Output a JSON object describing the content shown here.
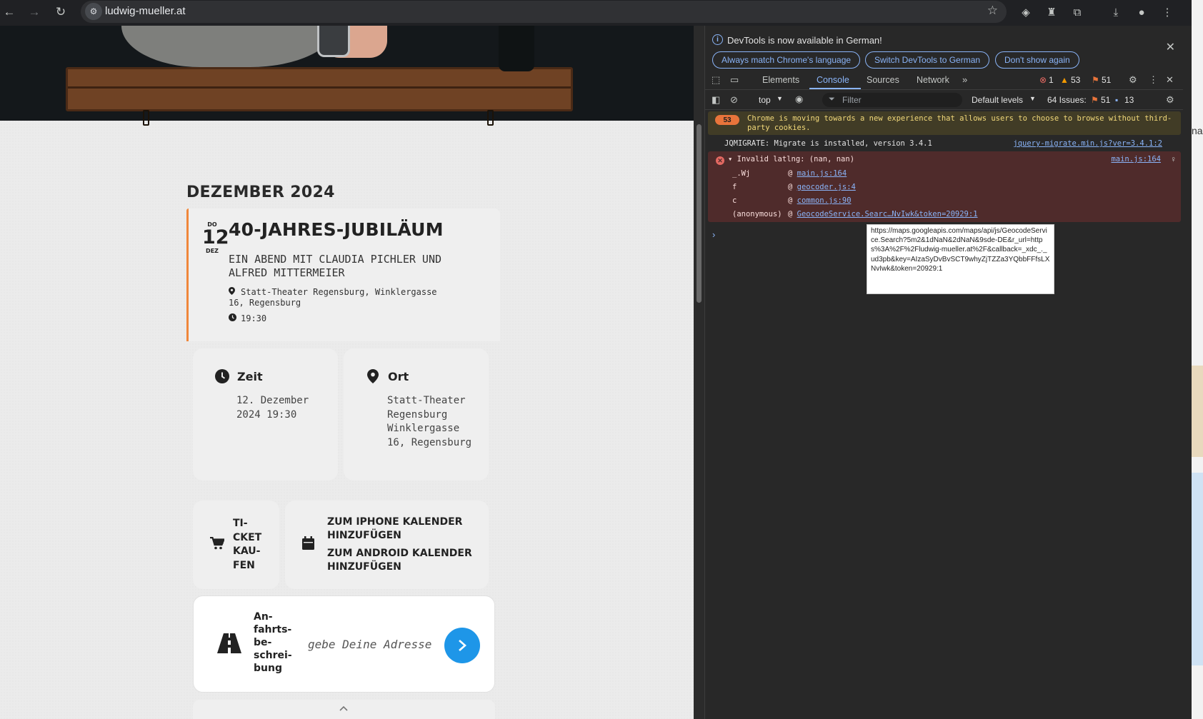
{
  "browser": {
    "url": "ludwig-mueller.at",
    "icons": [
      "back-icon",
      "forward-icon",
      "reload-icon",
      "site-settings-icon",
      "bookmark-star-icon",
      "shield-extension-icon",
      "hat-extension-icon",
      "extensions-icon",
      "download-icon",
      "profile-icon",
      "menu-icon"
    ]
  },
  "page": {
    "month_heading": "DEZEMBER 2024",
    "event": {
      "weekday": "DO",
      "day": "12",
      "month": "DEZ",
      "title": "40-JAHRES-JUBILÄUM",
      "subtitle": "EIN ABEND MIT CLAUDIA PICHLER UND ALFRED MITTERMEIER",
      "venue": "Statt-Theater Regensburg, Winklergasse 16, Regensburg",
      "time": "19:30",
      "accent_color": "#f0873b"
    },
    "zeit": {
      "label": "Zeit",
      "value": "12. Dezember 2024 19:30"
    },
    "ort": {
      "label": "Ort",
      "value": "Statt-Theater Regensburg Winklergasse 16, Regensburg"
    },
    "ticket_label": "TI-\nCKET\nKAU-\nFEN",
    "calendar": {
      "iphone": "ZUM IPHONE KALENDER HINZUFÜGEN",
      "android": "ZUM ANDROID KALENDER HINZUFÜGEN"
    },
    "route": {
      "label": "An-\nfahrts-\nbe-\nschrei-\nbung",
      "placeholder": "gebe Deine Adresse",
      "button_color": "#1e96e8"
    }
  },
  "devtools": {
    "infobar": {
      "text": "DevTools is now available in German!",
      "btn_match": "Always match Chrome's language",
      "btn_switch": "Switch DevTools to German",
      "btn_dont": "Don't show again"
    },
    "tabs": [
      "Elements",
      "Console",
      "Sources",
      "Network"
    ],
    "active_tab": "Console",
    "counts": {
      "errors": "1",
      "warnings": "53",
      "issues": "51"
    },
    "toolbar": {
      "context": "top",
      "filter_placeholder": "Filter",
      "levels": "Default levels",
      "issues_label": "64 Issues:",
      "issues_warn": "51",
      "issues_info": "13"
    },
    "console": {
      "warning": {
        "badge": "53",
        "text": "Chrome is moving towards a new experience that allows users to choose to browse without third-party cookies."
      },
      "info": {
        "text": "JQMIGRATE: Migrate is installed, version 3.4.1",
        "source": "jquery-migrate.min.js?ver=3.4.1:2"
      },
      "error": {
        "text": "Invalid latlng: (nan, nan)",
        "source": "main.js:164",
        "stack": [
          {
            "fn": "_.Wj",
            "src": "main.js:164"
          },
          {
            "fn": "f",
            "src": "geocoder.js:4"
          },
          {
            "fn": "c",
            "src": "common.js:90"
          },
          {
            "fn": "(anonymous)",
            "src": "GeocodeService.Searc…NvIwk&token=20929:1"
          }
        ]
      },
      "tooltip": "https://maps.googleapis.com/maps/api/js/GeocodeService.Search?5m2&1dNaN&2dNaN&9sde-DE&r_url=https%3A%2F%2Fludwig-mueller.at%2F&callback=_xdc_._ud3pb&key=AIzaSyDvBvSCT9whyZjTZZa3YQbbFFfsLXNvIwk&token=20929:1"
    }
  },
  "right_edge_text": "nare"
}
